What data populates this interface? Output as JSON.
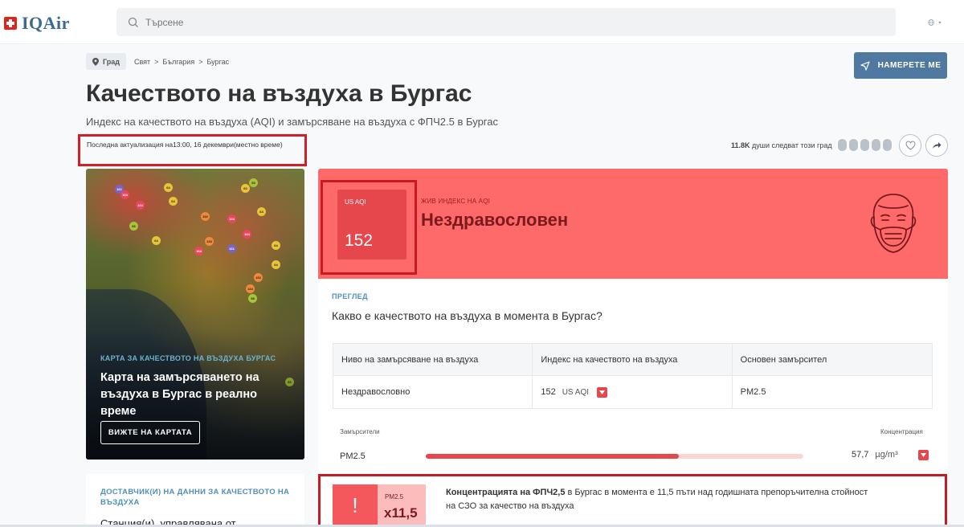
{
  "header": {
    "brand": "IQAir",
    "search_placeholder": "Търсене"
  },
  "breadcrumb": {
    "chip": "Град",
    "path": "Свят  >  България  >  Бургас"
  },
  "find_me_label": "НАМЕРЕТЕ МЕ",
  "page": {
    "title": "Качеството на въздуха в Бургас",
    "subtitle": "Индекс на качеството на въздуха (AQI) и замърсяване на въздуха с ФПЧ2.5 в Бургас",
    "last_update": "Последна актуализация на13:00, 16 декември(местно време)"
  },
  "followers": {
    "count": "11.8K",
    "text": " души следват този град"
  },
  "map_card": {
    "kicker": "КАРТА ЗА КАЧЕСТВОТО НА ВЪЗДУХА БУРГАС",
    "title": "Карта на замърсяването на въздуха в Бургас в реално време",
    "button": "ВИЖТЕ НА КАРТАТА"
  },
  "provider": {
    "kicker": "ДОСТАВЧИК(И) НА ДАННИ ЗА КАЧЕСТВОТО НА ВЪЗДУХА",
    "text": "Станция(и), управлявана от"
  },
  "aqi": {
    "label": "US AQI",
    "value": "152",
    "live_label": "ЖИВ ИНДЕКС НА AQI",
    "status": "Нездравословен",
    "color": "#fe6a69"
  },
  "overview": {
    "kicker": "ПРЕГЛЕД",
    "question": "Какво е качеството на въздуха в момента в Бургас?",
    "headers": [
      "Ниво на замърсяване на въздуха",
      "Индекс на качеството на въздуха",
      "Основен замърсител"
    ],
    "level": "Нездравословно",
    "aqi_value": "152",
    "aqi_unit": "US AQI",
    "main_pollutant": "PM2.5"
  },
  "pollutants": {
    "label": "Замърсители",
    "conc_label": "Концентрация",
    "name": "PM2.5",
    "value": "57,7",
    "unit": "µg/m³",
    "bar_level": 0.67
  },
  "alert": {
    "label": "PM2.5",
    "multiplier": "x11,5",
    "bold": "Концентрацията на ФПЧ2,5",
    "text": " в Бургас в момента е 11,5 пъти над годишната препоръчителна стойност на СЗО за качество на въздуха"
  },
  "map_stations": [
    "161",
    "164",
    "164",
    "64",
    "64",
    "53",
    "60",
    "64",
    "66",
    "152",
    "164",
    "164",
    "133",
    "164",
    "161",
    "64",
    "152",
    "64",
    "134",
    "58",
    "64",
    "66"
  ]
}
